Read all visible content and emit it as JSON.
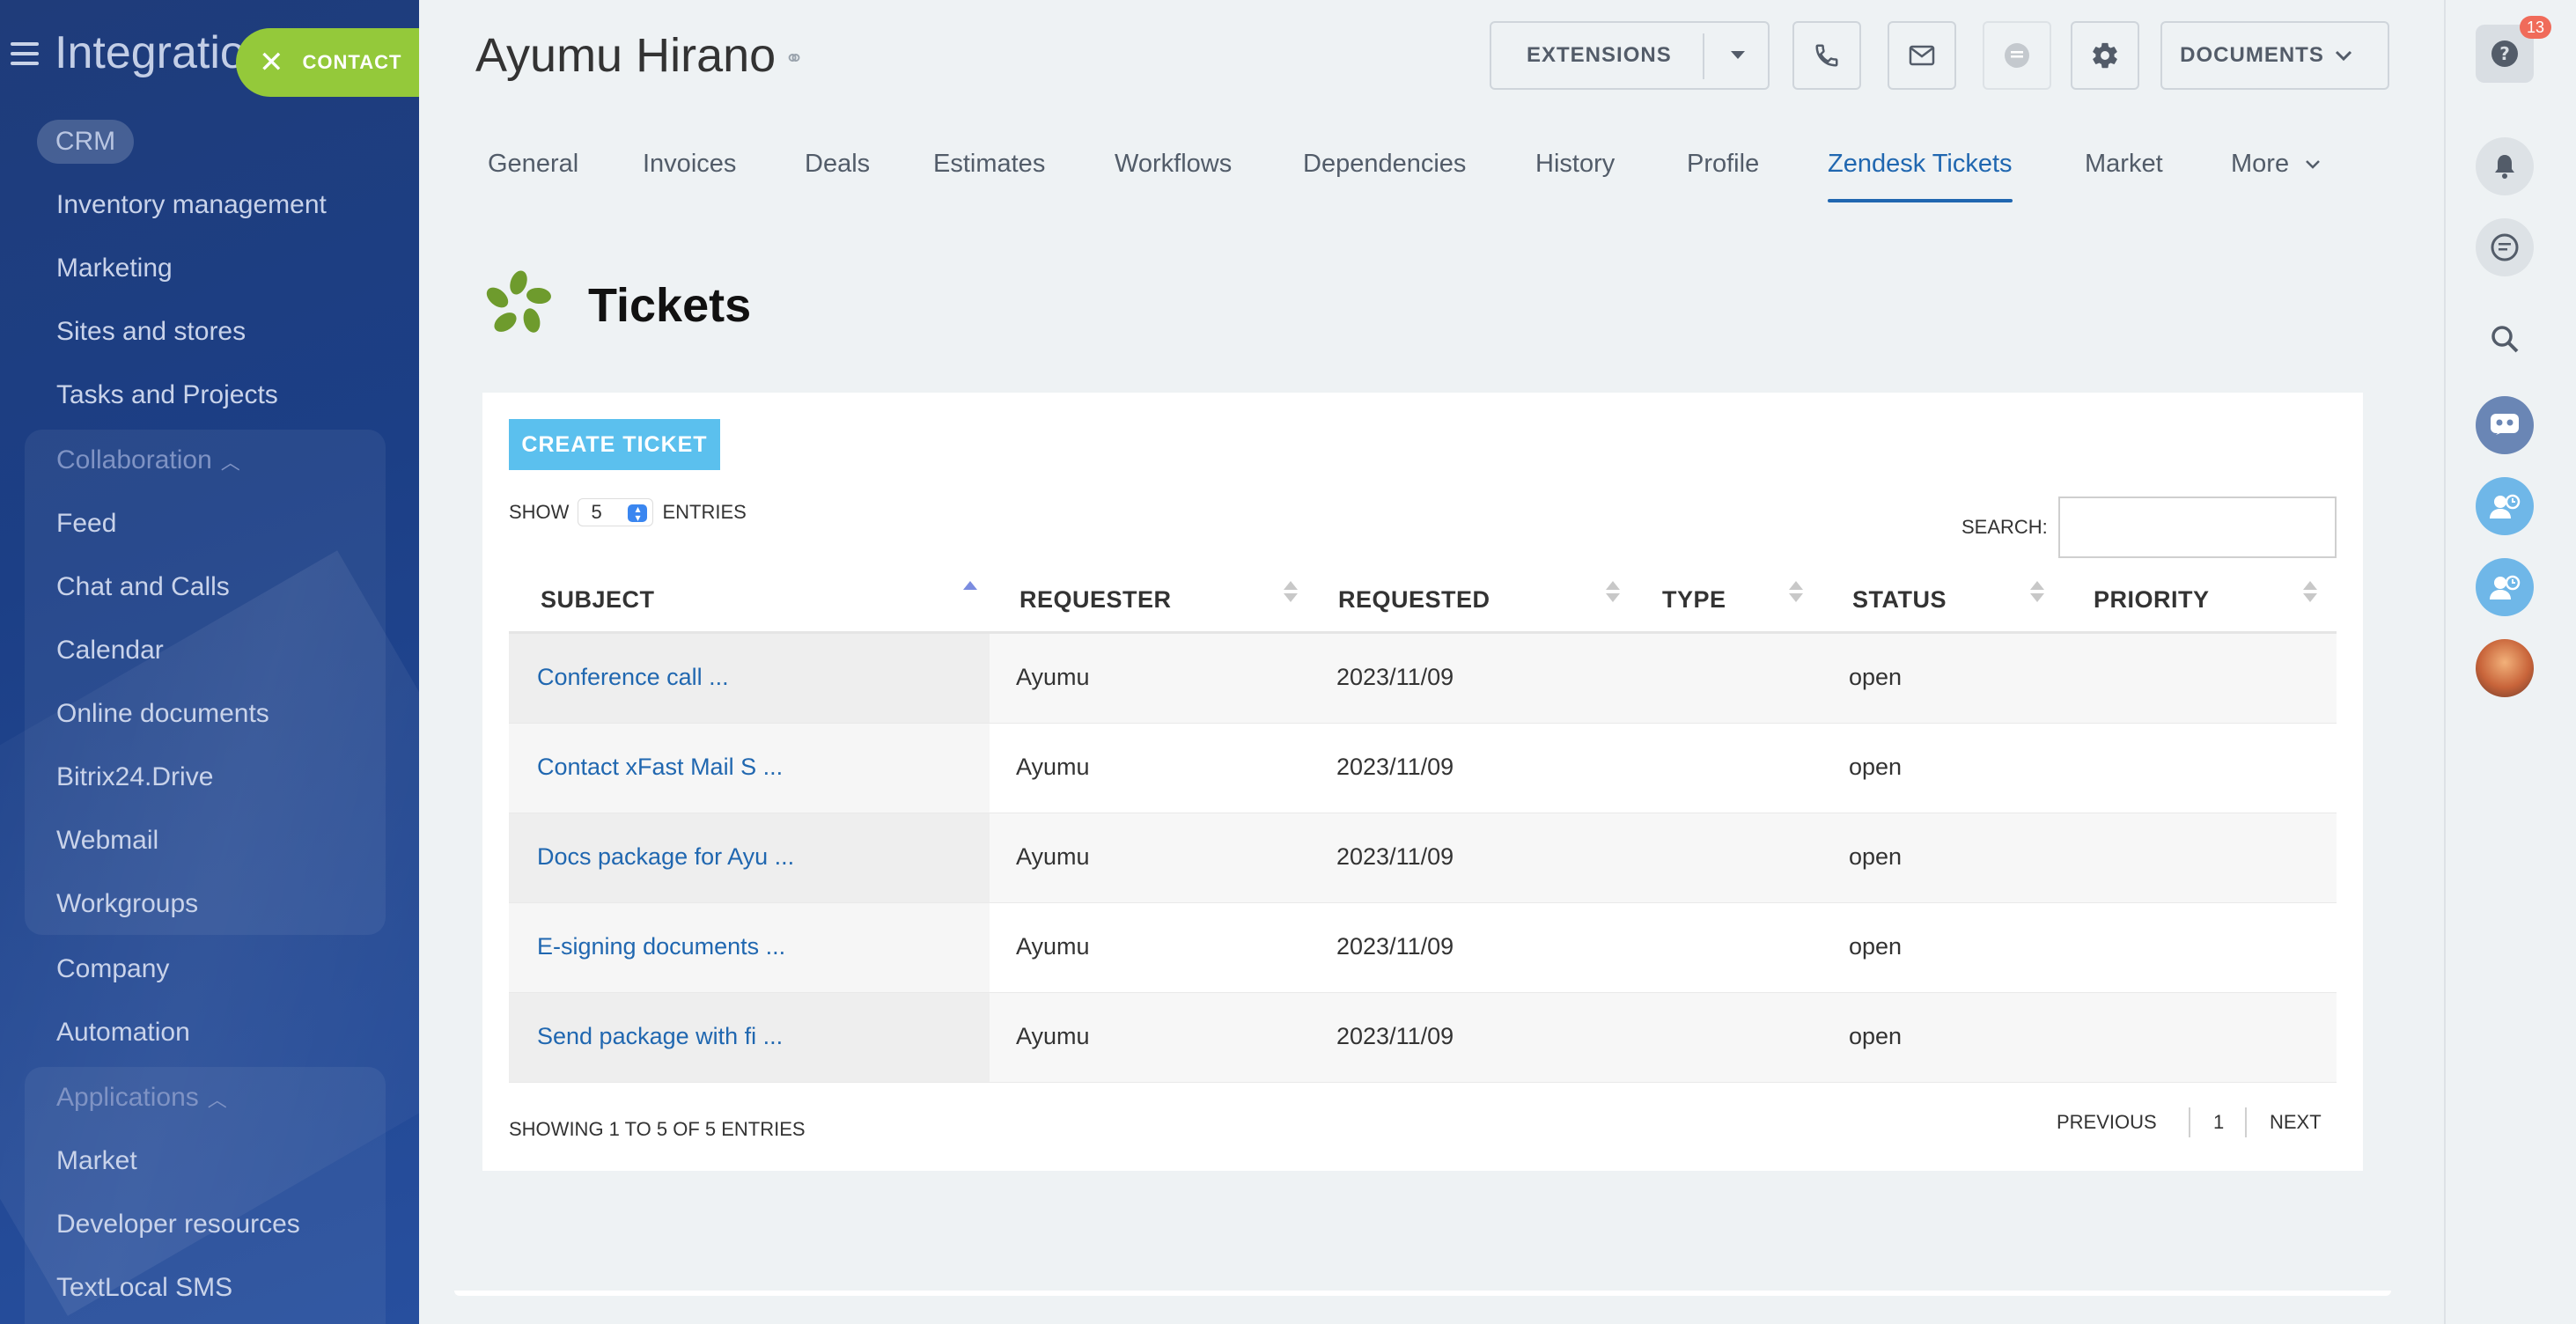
{
  "sidebar": {
    "title": "Integratio",
    "contact_label": "CONTACT",
    "crm_label": "CRM",
    "items_top": [
      "Inventory management",
      "Marketing",
      "Sites and stores",
      "Tasks and Projects"
    ],
    "collaboration": {
      "title": "Collaboration",
      "items": [
        "Feed",
        "Chat and Calls",
        "Calendar",
        "Online documents",
        "Bitrix24.Drive",
        "Webmail",
        "Workgroups"
      ]
    },
    "items_mid": [
      "Company",
      "Automation"
    ],
    "applications": {
      "title": "Applications",
      "items": [
        "Market",
        "Developer resources",
        "TextLocal SMS"
      ]
    }
  },
  "header": {
    "title": "Ayumu Hirano",
    "extensions_label": "EXTENSIONS",
    "documents_label": "DOCUMENTS"
  },
  "tabs": [
    "General",
    "Invoices",
    "Deals",
    "Estimates",
    "Workflows",
    "Dependencies",
    "History",
    "Profile",
    "Zendesk Tickets",
    "Market",
    "More"
  ],
  "active_tab": "Zendesk Tickets",
  "tickets": {
    "title": "Tickets",
    "create_label": "CREATE TICKET",
    "show_label": "SHOW",
    "show_value": "5",
    "entries_label": "ENTRIES",
    "search_label": "SEARCH:",
    "columns": [
      "SUBJECT",
      "REQUESTER",
      "REQUESTED",
      "TYPE",
      "STATUS",
      "PRIORITY"
    ],
    "rows": [
      {
        "subject": "Conference call ...",
        "requester": "Ayumu",
        "requested": "2023/11/09",
        "type": "",
        "status": "open",
        "priority": ""
      },
      {
        "subject": "Contact xFast Mail S ...",
        "requester": "Ayumu",
        "requested": "2023/11/09",
        "type": "",
        "status": "open",
        "priority": ""
      },
      {
        "subject": "Docs package for Ayu ...",
        "requester": "Ayumu",
        "requested": "2023/11/09",
        "type": "",
        "status": "open",
        "priority": ""
      },
      {
        "subject": "E-signing documents ...",
        "requester": "Ayumu",
        "requested": "2023/11/09",
        "type": "",
        "status": "open",
        "priority": ""
      },
      {
        "subject": "Send package with fi ...",
        "requester": "Ayumu",
        "requested": "2023/11/09",
        "type": "",
        "status": "open",
        "priority": ""
      }
    ],
    "showing_text": "SHOWING 1 TO 5 OF 5 ENTRIES",
    "pager": {
      "previous": "PREVIOUS",
      "page": "1",
      "next": "NEXT"
    }
  },
  "rail": {
    "help_badge": "13"
  },
  "colors": {
    "accent": "#2067b0",
    "contact_green": "#94c93a",
    "create_blue": "#5bc0ee",
    "badge_red": "#f06b5a",
    "sidebar_bg": "#1f3c7a"
  },
  "icons": {
    "link": "link-icon",
    "phone": "phone-icon",
    "mail": "mail-icon",
    "chat": "chat-icon",
    "settings": "gear-icon",
    "help": "help-icon",
    "bell": "bell-icon",
    "search": "search-icon"
  }
}
